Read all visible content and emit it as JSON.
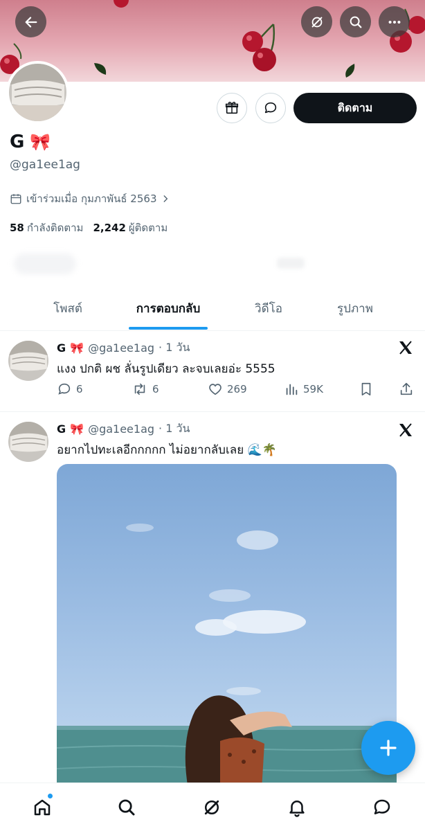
{
  "profile": {
    "name": "G",
    "name_emoji": "🎀",
    "handle": "@ga1ee1ag",
    "joined": "เข้าร่วมเมื่อ กุมภาพันธ์ 2563",
    "following_count": "58",
    "following_label": "กำลังติดตาม",
    "followers_count": "2,242",
    "followers_label": "ผู้ติดตาม",
    "follow_button": "ติดตาม"
  },
  "tabs": [
    {
      "label": "โพสต์",
      "active": false
    },
    {
      "label": "การตอบกลับ",
      "active": true
    },
    {
      "label": "วิดีโอ",
      "active": false
    },
    {
      "label": "รูปภาพ",
      "active": false
    }
  ],
  "posts": [
    {
      "name": "G",
      "emoji": "🎀",
      "handle": "@ga1ee1ag",
      "time": "· 1 วัน",
      "text": "แงง ปกติ ผช ลั่นรูปเดียว ละจบเลยอ่ะ 5555",
      "replies": "6",
      "reposts": "6",
      "likes": "269",
      "views": "59K"
    },
    {
      "name": "G",
      "emoji": "🎀",
      "handle": "@ga1ee1ag",
      "time": "· 1 วัน",
      "text": "อยากไปทะเลอีกกกกก ไม่อยากลับเลย 🌊🌴"
    }
  ],
  "colors": {
    "accent": "#1d9bf0",
    "text_primary": "#0f1419",
    "text_secondary": "#536471",
    "follow_button_bg": "#0f1419"
  },
  "icons": {
    "header": [
      "back-arrow-icon",
      "grok-icon",
      "search-icon",
      "more-icon"
    ],
    "bottom_nav": [
      "home-icon",
      "search-icon",
      "grok-icon",
      "notifications-icon",
      "messages-icon"
    ]
  }
}
